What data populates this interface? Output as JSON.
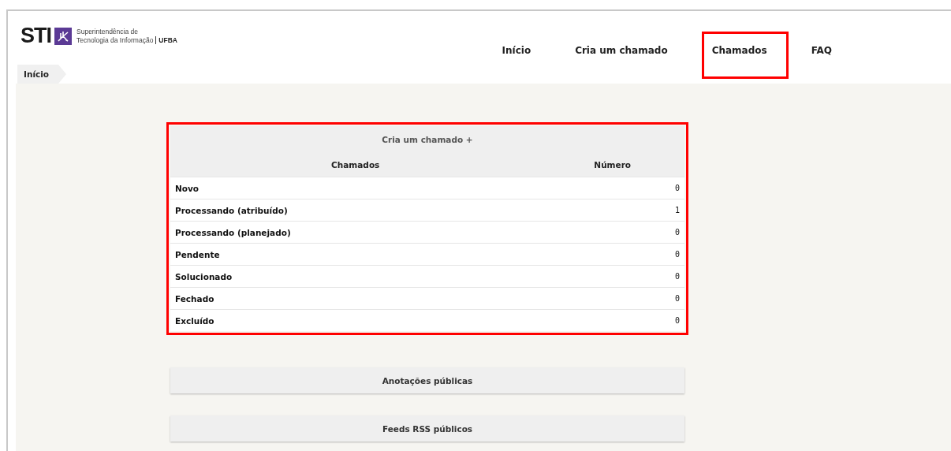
{
  "logo": {
    "mark": "STI",
    "line_1": "Superintendência de",
    "line_2": "Tecnologia da Informação",
    "org": "UFBA"
  },
  "nav": [
    {
      "label": "Início",
      "highlighted": false
    },
    {
      "label": "Cria um chamado",
      "highlighted": false
    },
    {
      "label": "Chamados",
      "highlighted": true
    },
    {
      "label": "FAQ",
      "highlighted": false
    }
  ],
  "breadcrumb": [
    "Início"
  ],
  "tickets_table": {
    "highlighted": true,
    "create_link": "Cria um chamado",
    "create_icon": "+",
    "columns": [
      "Chamados",
      "Número"
    ],
    "rows": [
      {
        "status": "Novo",
        "count": "0"
      },
      {
        "status": "Processando (atribuído)",
        "count": "1"
      },
      {
        "status": "Processando (planejado)",
        "count": "0"
      },
      {
        "status": "Pendente",
        "count": "0"
      },
      {
        "status": "Solucionado",
        "count": "0"
      },
      {
        "status": "Fechado",
        "count": "0"
      },
      {
        "status": "Excluído",
        "count": "0"
      }
    ]
  },
  "panels": [
    "Anotações públicas",
    "Feeds RSS públicos"
  ]
}
